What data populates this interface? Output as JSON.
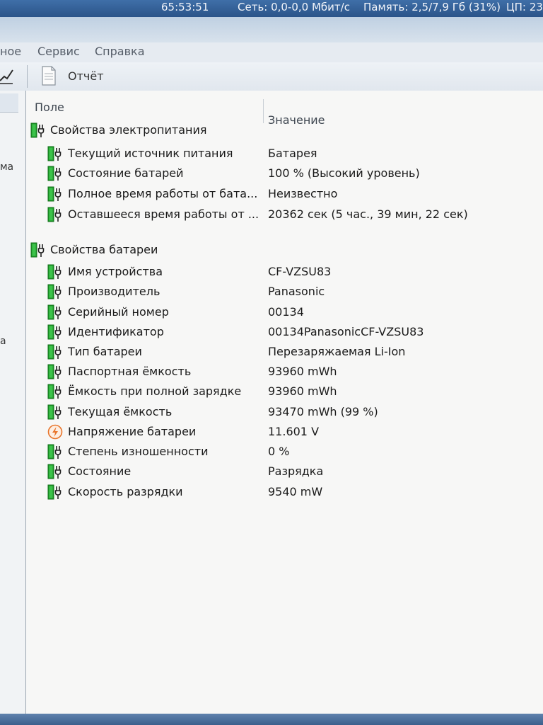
{
  "status_bar": {
    "items": [
      "65:53:51",
      "Сеть: 0,0-0,0 Мбит/с",
      "Память: 2,5/7,9 Гб (31%)",
      "ЦП: 23"
    ]
  },
  "menu": {
    "items": [
      "ное",
      "Сервис",
      "Справка"
    ]
  },
  "toolbar": {
    "report_label": "Отчёт"
  },
  "left_pane": {
    "fragments": [
      "ма",
      "а"
    ]
  },
  "columns": {
    "field": "Поле",
    "value": "Значение"
  },
  "groups": [
    {
      "title": "Свойства электропитания",
      "rows": [
        {
          "field": "Текущий источник питания",
          "value": "Батарея",
          "icon": "battery-icon"
        },
        {
          "field": "Состояние батарей",
          "value": "100 % (Высокий уровень)",
          "icon": "battery-icon"
        },
        {
          "field": "Полное время работы от бата...",
          "value": "Неизвестно",
          "icon": "battery-icon"
        },
        {
          "field": "Оставшееся время работы от ...",
          "value": "20362 сек (5 час., 39 мин, 22 сек)",
          "icon": "battery-icon"
        }
      ]
    },
    {
      "title": "Свойства батареи",
      "rows": [
        {
          "field": "Имя устройства",
          "value": "CF-VZSU83",
          "icon": "battery-icon"
        },
        {
          "field": "Производитель",
          "value": "Panasonic",
          "icon": "battery-icon"
        },
        {
          "field": "Серийный номер",
          "value": "00134",
          "icon": "battery-icon"
        },
        {
          "field": "Идентификатор",
          "value": "00134PanasonicCF-VZSU83",
          "icon": "battery-icon"
        },
        {
          "field": "Тип батареи",
          "value": "Перезаряжаемая Li-Ion",
          "icon": "battery-icon"
        },
        {
          "field": "Паспортная ёмкость",
          "value": "93960 mWh",
          "icon": "battery-icon"
        },
        {
          "field": "Ёмкость при полной зарядке",
          "value": "93960 mWh",
          "icon": "battery-icon"
        },
        {
          "field": "Текущая ёмкость",
          "value": "93470 mWh  (99 %)",
          "icon": "battery-icon"
        },
        {
          "field": "Напряжение батареи",
          "value": "11.601 V",
          "icon": "voltage-icon"
        },
        {
          "field": "Степень изношенности",
          "value": "0 %",
          "icon": "battery-icon"
        },
        {
          "field": "Состояние",
          "value": "Разрядка",
          "icon": "battery-icon"
        },
        {
          "field": "Скорость разрядки",
          "value": "9540 mW",
          "icon": "battery-icon"
        }
      ]
    }
  ],
  "colors": {
    "battery_green": "#1e9a2a",
    "voltage_orange": "#e8742a",
    "titlebar_blue": "#2f5c94"
  }
}
